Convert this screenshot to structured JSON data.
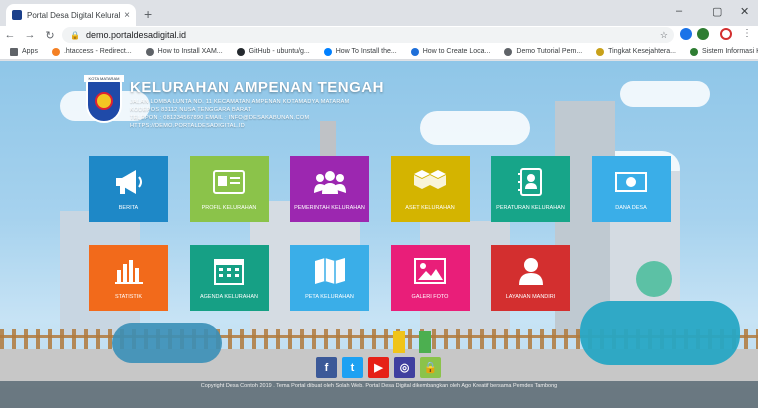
{
  "browser": {
    "tab_title": "Portal Desa Digital Kelurahan Am",
    "tab_close": "×",
    "new_tab": "+",
    "url": "demo.portaldesadigital.id",
    "win_min": "–",
    "win_max": "▢",
    "win_close": "✕",
    "bookmarks": [
      {
        "label": "Apps",
        "icon": "apps-grid-icon",
        "color": "#5f6368"
      },
      {
        "label": ".htaccess - Redirect...",
        "icon": "stackoverflow-icon",
        "color": "#f48024"
      },
      {
        "label": "How to Install XAM...",
        "icon": "site-icon",
        "color": "#5f6368"
      },
      {
        "label": "GitHub - ubuntu/g...",
        "icon": "github-icon",
        "color": "#24292e"
      },
      {
        "label": "How To Install the...",
        "icon": "digitalocean-icon",
        "color": "#0080ff"
      },
      {
        "label": "How to Create Loca...",
        "icon": "shield-icon",
        "color": "#1e6fd9"
      },
      {
        "label": "Demo Tutorial Pem...",
        "icon": "site-icon",
        "color": "#5f6368"
      },
      {
        "label": "Tingkat Kesejahtera...",
        "icon": "garuda-icon",
        "color": "#c8a11a"
      },
      {
        "label": "Sistem Informasi Ka...",
        "icon": "site-icon",
        "color": "#2e7d32"
      }
    ]
  },
  "header": {
    "logo_caption": "KOTA MATARAM",
    "title": "KELURAHAN AMPENAN TENGAH",
    "lines": [
      "JALAN LOMBA LUNTA NO. 11 KECAMATAN AMPENAN KOTAMADYA MATARAM",
      "KODEPOS 83112 NUSA TENGGARA BARAT",
      "TELEPON : 081234567890 EMAIL : INFO@DESAKABUNAN.COM",
      "HTTPS://DEMO.PORTALDESADIGITAL.ID"
    ]
  },
  "menu": [
    {
      "label": "BERITA",
      "icon": "megaphone-icon",
      "color": "#1e88c7"
    },
    {
      "label": "PROFIL KELURAHAN",
      "icon": "id-card-icon",
      "color": "#8bc34a"
    },
    {
      "label": "PEMERINTAH KELURAHAN",
      "icon": "people-group-icon",
      "color": "#9c27b0"
    },
    {
      "label": "ASET KELURAHAN",
      "icon": "boxes-icon",
      "color": "#d4b400"
    },
    {
      "label": "PERATURAN KELURAHAN",
      "icon": "address-book-icon",
      "color": "#17a589"
    },
    {
      "label": "DANA DESA",
      "icon": "banknote-icon",
      "color": "#3aaee8"
    },
    {
      "label": "STATISTIK",
      "icon": "bar-chart-icon",
      "color": "#f26a1b"
    },
    {
      "label": "AGENDA KELURAHAN",
      "icon": "calendar-icon",
      "color": "#16a085"
    },
    {
      "label": "PETA KELURAHAN",
      "icon": "map-icon",
      "color": "#3aaee8"
    },
    {
      "label": "GALERI FOTO",
      "icon": "image-icon",
      "color": "#e91e79"
    },
    {
      "label": "LAYANAN MANDIRI",
      "icon": "user-icon",
      "color": "#d32f2f"
    }
  ],
  "social": [
    {
      "label": "f",
      "icon": "facebook-icon",
      "color": "#3b5998"
    },
    {
      "label": "t",
      "icon": "twitter-icon",
      "color": "#1da1f2"
    },
    {
      "label": "▶",
      "icon": "youtube-icon",
      "color": "#e62117"
    },
    {
      "label": "◎",
      "icon": "instagram-icon",
      "color": "#3f3f9f"
    },
    {
      "label": "🔒",
      "icon": "lock-icon",
      "color": "#8bc34a"
    }
  ],
  "footer": "Copyright Desa Contoh 2019 . Tema Portal dibuat oleh Solah Web. Portal Desa Digital dikembangkan oleh Ago Kreatif bersama Pemdes Tambong"
}
